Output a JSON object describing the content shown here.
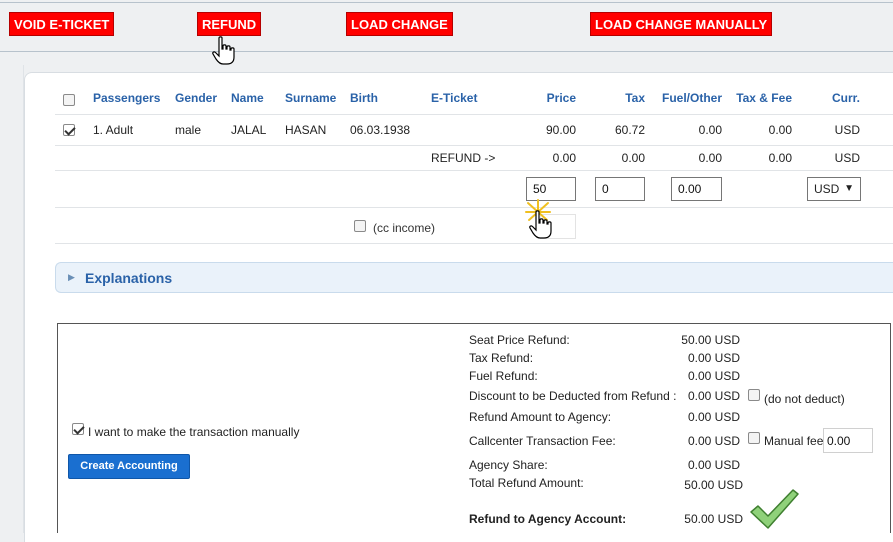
{
  "toolbar": {
    "void_label": "VOID E-TICKET",
    "refund_label": "REFUND",
    "load_change_label": "LOAD CHANGE",
    "load_change_manually_label": "LOAD CHANGE MANUALLY",
    "button_color": "#ff0000"
  },
  "table": {
    "headers": [
      "Passengers",
      "Gender",
      "Name",
      "Surname",
      "Birth",
      "E-Ticket",
      "Price",
      "Tax",
      "Fuel/Other",
      "Tax & Fee",
      "Curr."
    ],
    "passenger": {
      "checked": true,
      "passenger": "1. Adult",
      "gender": "male",
      "name": "JALAL",
      "surname": "HASAN",
      "birth": "06.03.1938",
      "eticket": "",
      "price": "90.00",
      "tax": "60.72",
      "fuel": "0.00",
      "taxfee": "0.00",
      "curr": "USD"
    },
    "refund_row": {
      "label": "REFUND ->",
      "price": "0.00",
      "tax": "0.00",
      "fuel": "0.00",
      "taxfee": "0.00",
      "curr": "USD"
    },
    "inputs": {
      "price": "50",
      "tax": "0",
      "fuel": "0.00",
      "currency": "USD"
    },
    "cc_income_label": "(cc income)"
  },
  "explanations": {
    "label": "Explanations"
  },
  "summary": {
    "manual_label": "I want to make the transaction manually",
    "manual_checked": true,
    "create_button": "Create Accounting",
    "rows": [
      {
        "label": "Seat Price Refund:",
        "value": "50.00 USD"
      },
      {
        "label": "Tax Refund:",
        "value": "0.00 USD"
      },
      {
        "label": "Fuel Refund:",
        "value": "0.00 USD"
      },
      {
        "label": "Discount to be Deducted from Refund :",
        "value": "0.00 USD"
      },
      {
        "label": "Refund Amount to Agency:",
        "value": "0.00 USD"
      },
      {
        "label": "Callcenter Transaction Fee:",
        "value": "0.00 USD"
      },
      {
        "label": "Agency Share:",
        "value": "0.00 USD"
      },
      {
        "label": "Total Refund Amount:",
        "value": "50.00 USD"
      },
      {
        "label": "Refund to Agency Account:",
        "value": "50.00 USD"
      }
    ],
    "do_not_deduct_label": "(do not deduct)",
    "manual_fee_label": "Manual fee",
    "manual_fee_value": "0.00",
    "accent": "#1a6fd0",
    "check_color": "#4a9e3a"
  }
}
